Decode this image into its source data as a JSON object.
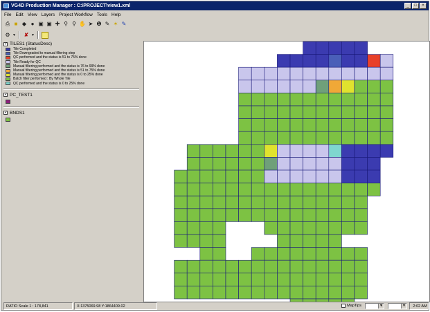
{
  "window": {
    "title": "VG4D Production Manager : C:\\PROJECT\\view1.xml",
    "minimize": "_",
    "maximize": "□",
    "close": "×"
  },
  "menu": [
    "File",
    "Edit",
    "View",
    "Layers",
    "Project Workflow",
    "Tools",
    "Help"
  ],
  "toolbar1_icons": [
    "print-icon",
    "open-folder-icon",
    "layers-icon",
    "binoculars-icon",
    "save-icon",
    "save-as-icon",
    "pan-icon",
    "zoom-in-icon",
    "zoom-out-icon",
    "hand-icon",
    "select-arrow-icon",
    "info-icon",
    "find-icon",
    "star-icon",
    "pencil-icon"
  ],
  "toolbar2_icons": [
    "tools-dropdown-icon",
    "wrench-dropdown-icon",
    "highlight-box-icon"
  ],
  "legend": {
    "layers": [
      {
        "name": "TILES1 (StatusDesc)",
        "checked": true,
        "entries": [
          {
            "color": "#3b3bb0",
            "label": "Tile Completed"
          },
          {
            "color": "#4a5fb8",
            "label": "Tile Downgraded to manual filtering step"
          },
          {
            "color": "#e8412a",
            "label": "QC performed and the status is 51 to 75% done"
          },
          {
            "color": "#c9c6ec",
            "label": "Tile Ready for QC"
          },
          {
            "color": "#6fa07a",
            "label": "Manual filtering performed and the status is 76 to 99% done"
          },
          {
            "color": "#f0a837",
            "label": "Manual filtering performed and the status is 51 to 75% done"
          },
          {
            "color": "#e0e22e",
            "label": "Manual filtering performed and the status is 0 to 25% done"
          },
          {
            "color": "#7dc243",
            "label": "Batch filter performed : By Whole Tile"
          },
          {
            "color": "#7fd6cf",
            "label": "QC performed and the status is 0 to 25% done"
          }
        ]
      },
      {
        "name": "PC_TEST1",
        "checked": true,
        "color": "#8c1f7a"
      },
      {
        "name": "BNDS1",
        "checked": true,
        "color": "#7dc243"
      }
    ]
  },
  "map": {
    "grid_color": "#1a1a7a",
    "tiles": [
      {
        "color": "#3b3bb0",
        "cells": [
          [
            11,
            0
          ],
          [
            12,
            0
          ],
          [
            13,
            0
          ],
          [
            14,
            0
          ],
          [
            15,
            0
          ],
          [
            9,
            1
          ],
          [
            10,
            1
          ],
          [
            11,
            1
          ],
          [
            12,
            1
          ],
          [
            14,
            1
          ],
          [
            15,
            1
          ],
          [
            14,
            8
          ],
          [
            15,
            8
          ],
          [
            16,
            8
          ],
          [
            17,
            8
          ],
          [
            14,
            9
          ],
          [
            15,
            9
          ],
          [
            16,
            9
          ],
          [
            14,
            10
          ],
          [
            15,
            10
          ],
          [
            16,
            10
          ]
        ]
      },
      {
        "color": "#4a5fb8",
        "cells": [
          [
            13,
            1
          ]
        ]
      },
      {
        "color": "#e8412a",
        "cells": [
          [
            16,
            1
          ]
        ]
      },
      {
        "color": "#c9c6ec",
        "cells": [
          [
            17,
            1
          ],
          [
            6,
            2
          ],
          [
            7,
            2
          ],
          [
            8,
            2
          ],
          [
            9,
            2
          ],
          [
            10,
            2
          ],
          [
            11,
            2
          ],
          [
            12,
            2
          ],
          [
            13,
            2
          ],
          [
            14,
            2
          ],
          [
            15,
            2
          ],
          [
            16,
            2
          ],
          [
            17,
            2
          ],
          [
            6,
            3
          ],
          [
            7,
            3
          ],
          [
            8,
            3
          ],
          [
            9,
            3
          ],
          [
            10,
            3
          ],
          [
            11,
            3
          ],
          [
            14,
            3
          ],
          [
            9,
            8
          ],
          [
            10,
            8
          ],
          [
            11,
            8
          ],
          [
            12,
            8
          ],
          [
            8,
            9
          ],
          [
            9,
            9
          ],
          [
            10,
            9
          ],
          [
            11,
            9
          ],
          [
            12,
            9
          ],
          [
            13,
            9
          ],
          [
            8,
            10
          ],
          [
            9,
            10
          ],
          [
            10,
            10
          ],
          [
            11,
            10
          ],
          [
            12,
            10
          ],
          [
            13,
            10
          ]
        ]
      },
      {
        "color": "#6fa07a",
        "cells": [
          [
            12,
            3
          ],
          [
            8,
            9
          ]
        ]
      },
      {
        "color": "#f0a837",
        "cells": [
          [
            13,
            3
          ]
        ]
      },
      {
        "color": "#e0e22e",
        "cells": [
          [
            14,
            3
          ],
          [
            8,
            8
          ]
        ]
      },
      {
        "color": "#7fd6cf",
        "cells": [
          [
            13,
            8
          ]
        ]
      }
    ]
  },
  "status": {
    "scale": "RATIO Scale 1 : 178,841",
    "coords": "X:1375069.98 Y:1864409.02",
    "maptips_label": "MapTips",
    "time": "2:02 AM"
  }
}
